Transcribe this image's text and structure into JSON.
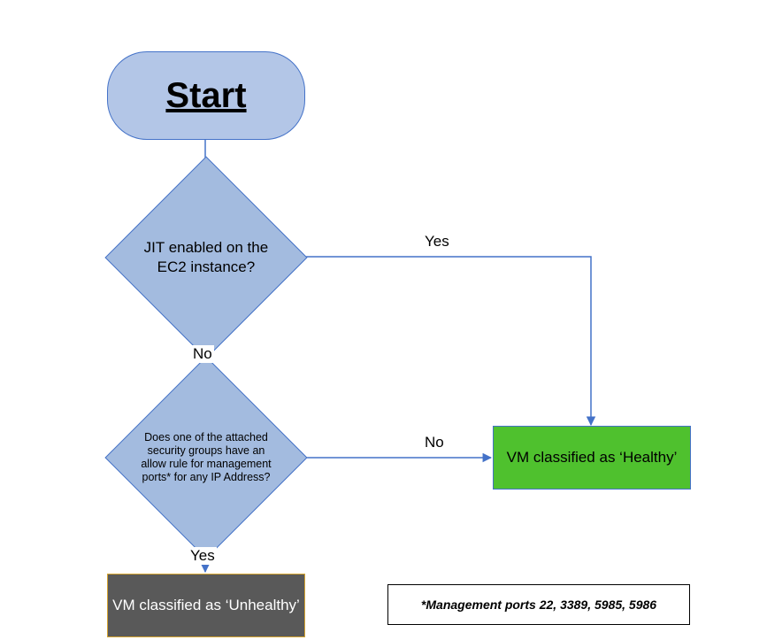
{
  "chart_data": {
    "type": "flowchart",
    "nodes": [
      {
        "id": "start",
        "kind": "terminator",
        "label": "Start"
      },
      {
        "id": "d1",
        "kind": "decision",
        "label": "JIT enabled on the EC2 instance?"
      },
      {
        "id": "d2",
        "kind": "decision",
        "label": "Does one of the attached security groups have an allow rule for management ports* for any IP Address?"
      },
      {
        "id": "healthy",
        "kind": "process",
        "label": "VM classified as ‘Healthy’"
      },
      {
        "id": "unhealthy",
        "kind": "process",
        "label": "VM classified as ‘Unhealthy’"
      }
    ],
    "edges": [
      {
        "from": "start",
        "to": "d1",
        "label": ""
      },
      {
        "from": "d1",
        "to": "healthy",
        "label": "Yes"
      },
      {
        "from": "d1",
        "to": "d2",
        "label": "No"
      },
      {
        "from": "d2",
        "to": "healthy",
        "label": "No"
      },
      {
        "from": "d2",
        "to": "unhealthy",
        "label": "Yes"
      }
    ],
    "footnote": "*Management ports 22, 3389, 5985, 5986"
  },
  "nodes": {
    "start": "Start",
    "d1": "JIT enabled on the EC2 instance?",
    "d2": "Does one of the attached security groups have an allow rule for management ports* for any IP Address?",
    "healthy": "VM classified as ‘Healthy’",
    "unhealthy": "VM classified as ‘Unhealthy’"
  },
  "edges": {
    "d1_yes": "Yes",
    "d1_no": "No",
    "d2_no": "No",
    "d2_yes": "Yes"
  },
  "footnote": "*Management ports 22, 3389, 5985, 5986"
}
